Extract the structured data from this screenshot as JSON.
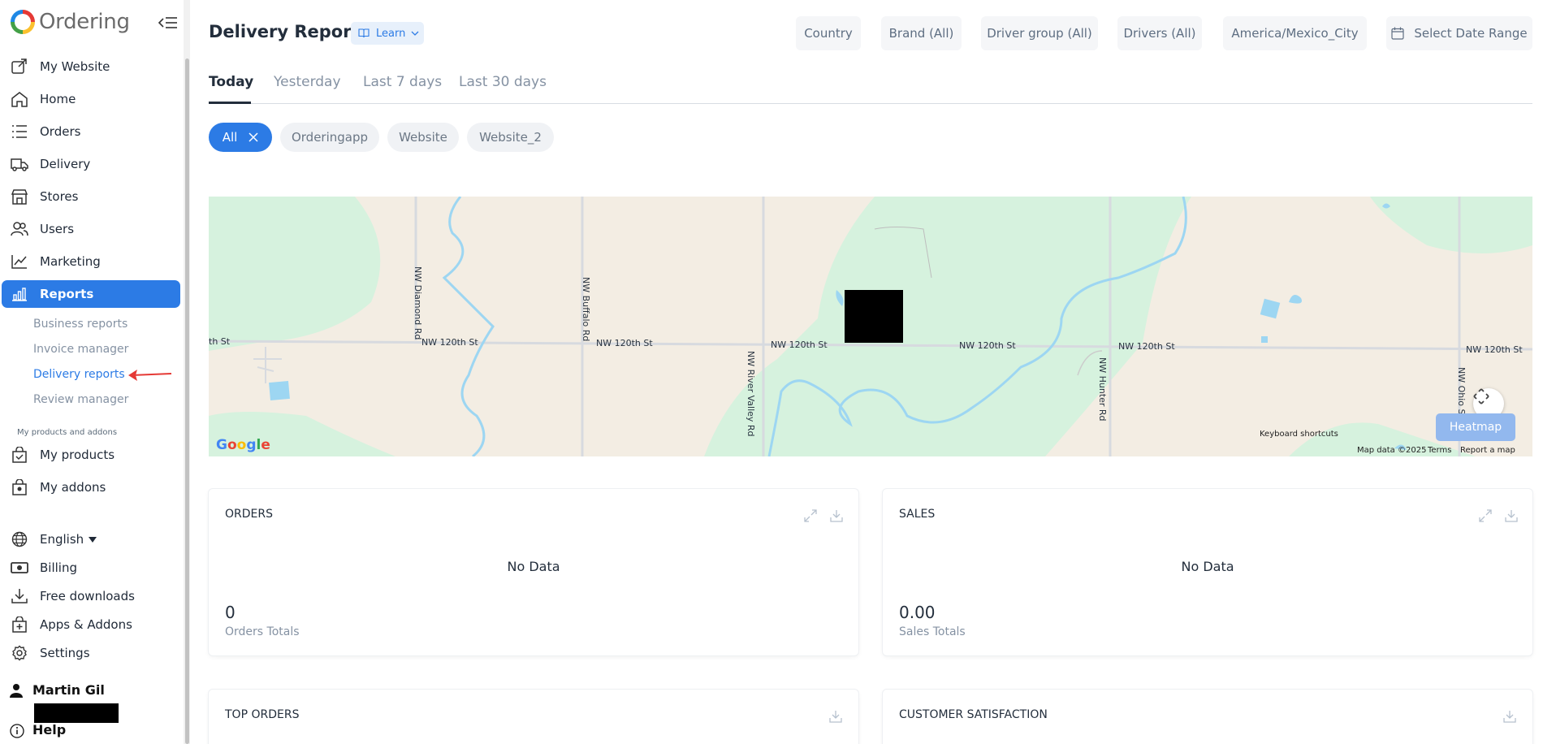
{
  "sidebar": {
    "brand": "Ordering",
    "nav": [
      "My Website",
      "Home",
      "Orders",
      "Delivery",
      "Stores",
      "Users",
      "Marketing",
      "Reports",
      "My products",
      "My addons",
      "Billing",
      "Free downloads",
      "Apps & Addons",
      "Settings"
    ],
    "active_nav": "Reports",
    "sub": [
      "Business reports",
      "Invoice manager",
      "Delivery reports",
      "Review manager"
    ],
    "active_sub": "Delivery reports",
    "section_label": "My products and addons",
    "language": "English",
    "user_name": "Martin Gil",
    "help": "Help",
    "icons": [
      "external-link-icon",
      "home-icon",
      "list-icon",
      "truck-icon",
      "store-icon",
      "users-icon",
      "line-chart-icon",
      "bar-chart-icon",
      "bag-check-icon",
      "bag-icon",
      "globe-icon",
      "cash-icon",
      "download-icon",
      "bag-plus-icon",
      "gear-icon"
    ]
  },
  "header": {
    "title": "Delivery Reports",
    "learn_label": "Learn",
    "filters": [
      "Country",
      "Brand (All)",
      "Driver group (All)",
      "Drivers (All)",
      "America/Mexico_City"
    ],
    "date_range": "Select Date Range"
  },
  "tabs": [
    "Today",
    "Yesterday",
    "Last 7 days",
    "Last 30 days"
  ],
  "active_tab": "Today",
  "chips": [
    "All",
    "Orderingapp",
    "Website",
    "Website_2"
  ],
  "active_chip": "All",
  "map": {
    "streets": [
      "th St",
      "NW 120th St",
      "NW Diamond Rd",
      "NW Buffalo Rd",
      "NW River Valley Rd",
      "NW Hunter Rd",
      "NW Ohio Street"
    ],
    "google": [
      "G",
      "o",
      "o",
      "g",
      "l",
      "e"
    ],
    "heatmap_label": "Heatmap",
    "keyboard_shortcuts": "Keyboard shortcuts",
    "map_data": "Map data ©2025",
    "terms": "Terms",
    "report_error": "Report a map error"
  },
  "cards": {
    "orders": {
      "title": "ORDERS",
      "empty": "No Data",
      "value": "0",
      "caption": "Orders Totals"
    },
    "sales": {
      "title": "SALES",
      "empty": "No Data",
      "value": "0.00",
      "caption": "Sales Totals"
    },
    "top_orders": {
      "title": "TOP ORDERS"
    },
    "customer_satisfaction": {
      "title": "CUSTOMER SATISFACTION"
    }
  },
  "colors": {
    "accent": "#2c7be5",
    "text_dark": "#232e3c",
    "text_muted": "#8592a3",
    "pill_bg": "#f5f6f8",
    "annotation_arrow": "#e53935",
    "map_land": "#f3ede3",
    "map_park": "#d6f2de",
    "map_water": "#9dd6f2"
  }
}
